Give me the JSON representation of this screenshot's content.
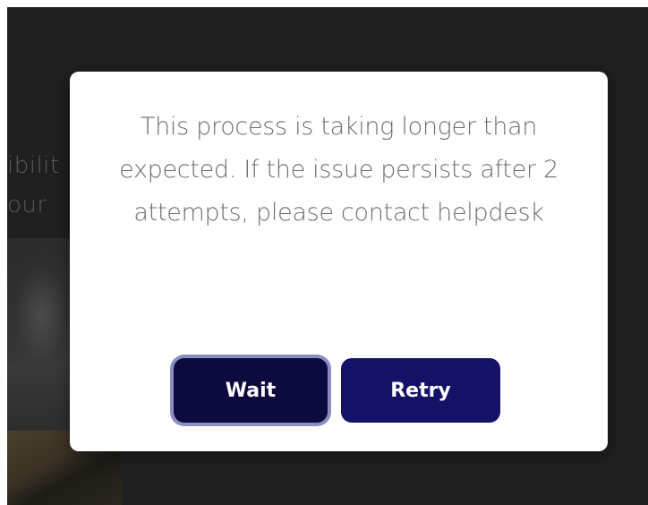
{
  "background": {
    "partial_line_1": "ibilit",
    "partial_line_2": "our"
  },
  "dialog": {
    "message": "This process is taking longer than expected. If the issue persists after 2 attempts, please contact helpdesk",
    "buttons": {
      "wait_label": "Wait",
      "retry_label": "Retry"
    }
  },
  "colors": {
    "overlay": "#1f1f1f",
    "dialog_bg": "#ffffff",
    "wait_button": "#0c0a3e",
    "wait_focus_ring": "#8a8fc2",
    "retry_button": "#131266",
    "message_text": "#6e6e6e"
  }
}
